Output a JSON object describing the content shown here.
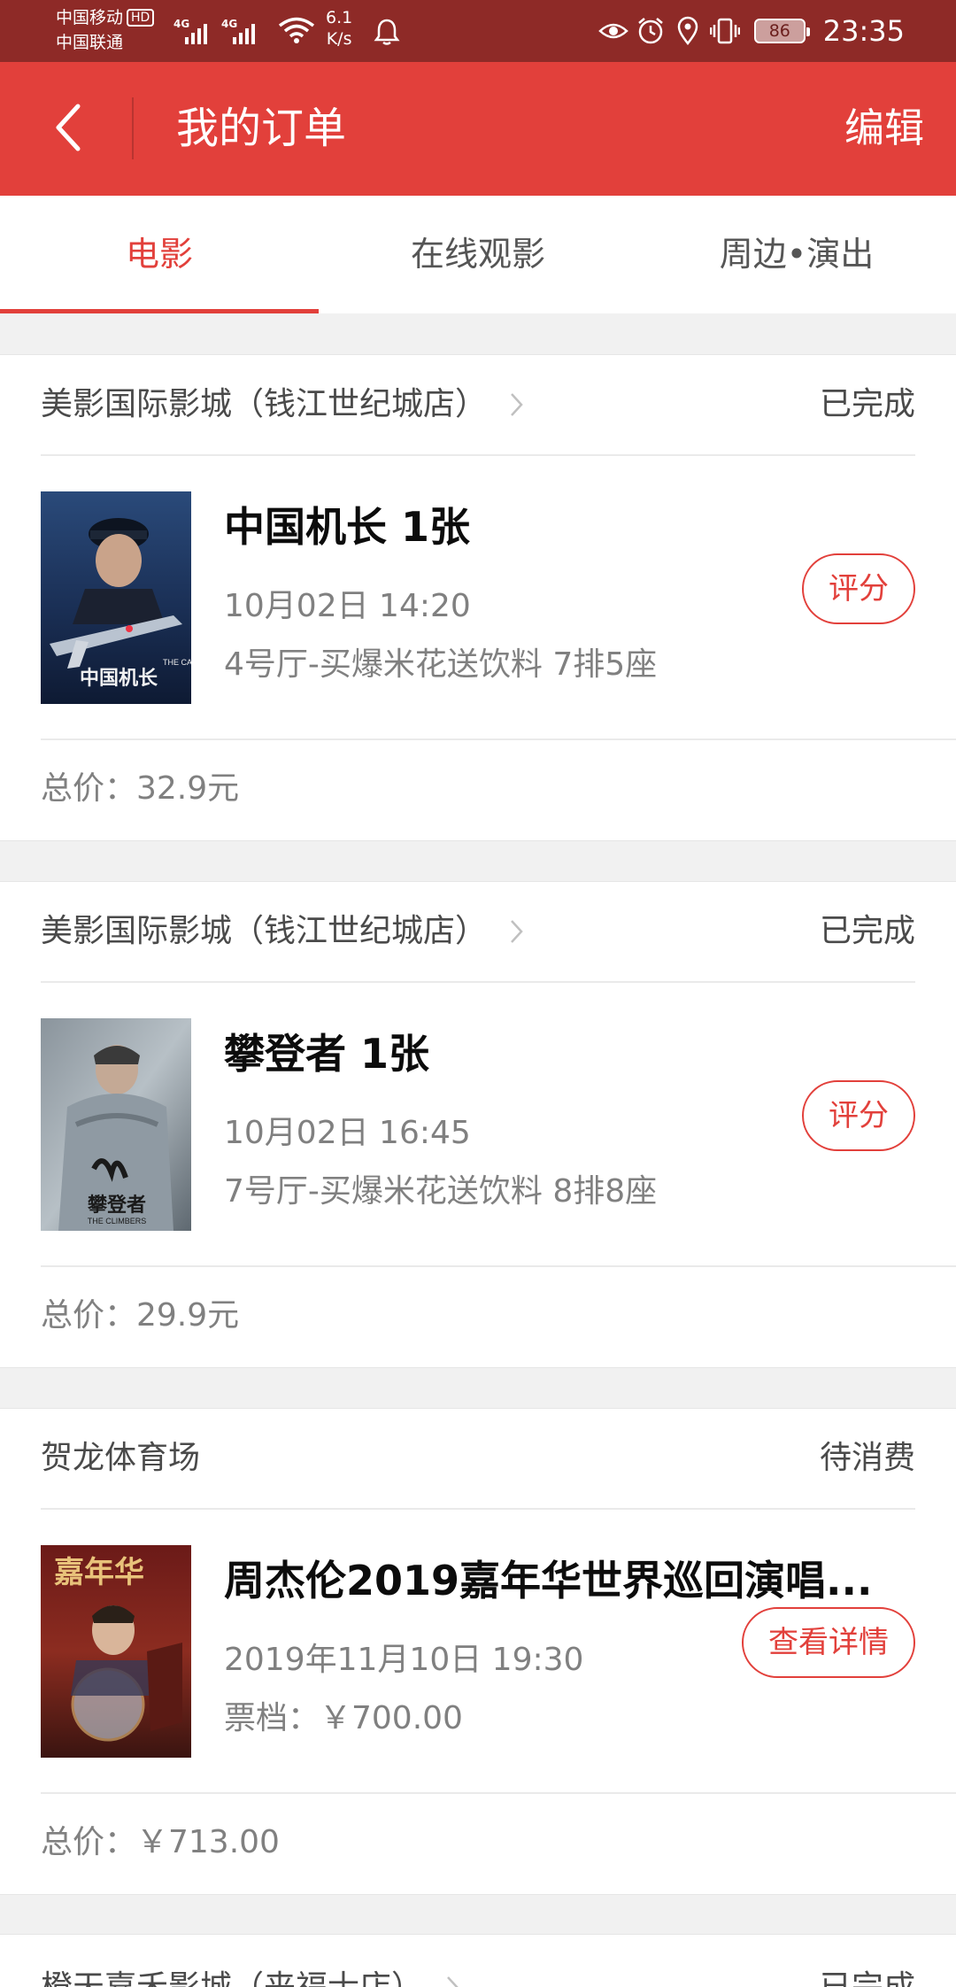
{
  "status_bar": {
    "carrier1": "中国移动",
    "hd": "HD",
    "carrier2": "中国联通",
    "net1": "4G",
    "net2": "4G",
    "speed_value": "6.1",
    "speed_unit": "K/s",
    "battery": "86",
    "time": "23:35",
    "icons": [
      "eye-icon",
      "alarm-icon",
      "location-icon",
      "vibrate-icon",
      "battery-icon"
    ]
  },
  "header": {
    "title": "我的订单",
    "edit": "编辑"
  },
  "tabs": [
    {
      "label": "电影",
      "active": true
    },
    {
      "label": "在线观影",
      "active": false
    },
    {
      "label": "周边•演出",
      "active": false
    }
  ],
  "orders": [
    {
      "cinema": "美影国际影城（钱江世纪城店）",
      "status": "已完成",
      "title": "中国机长 1张",
      "time": "10月02日 14:20",
      "info": "4号厅-买爆米花送饮料 7排5座",
      "button": "评分",
      "total": "总价：32.9元",
      "poster": {
        "title_en": "THE CAPTAIN",
        "title_cn": "中国机长"
      }
    },
    {
      "cinema": "美影国际影城（钱江世纪城店）",
      "status": "已完成",
      "title": "攀登者 1张",
      "time": "10月02日 16:45",
      "info": "7号厅-买爆米花送饮料 8排8座",
      "button": "评分",
      "total": "总价：29.9元",
      "poster": {
        "title_cn": "攀登者",
        "title_en": "THE CLIMBERS"
      }
    },
    {
      "cinema": "贺龙体育场",
      "status": "待消费",
      "title": "周杰伦2019嘉年华世界巡回演唱...",
      "time": "2019年11月10日 19:30",
      "info": "票档：￥700.00",
      "button": "查看详情",
      "total": "总价：￥713.00",
      "poster": {
        "title_cn": "嘉年华"
      }
    },
    {
      "cinema": "橙天嘉禾影城（来福士店）",
      "status": "已完成"
    }
  ],
  "colors": {
    "brand_red": "#e2403b",
    "status_bar": "#8e2a27"
  }
}
